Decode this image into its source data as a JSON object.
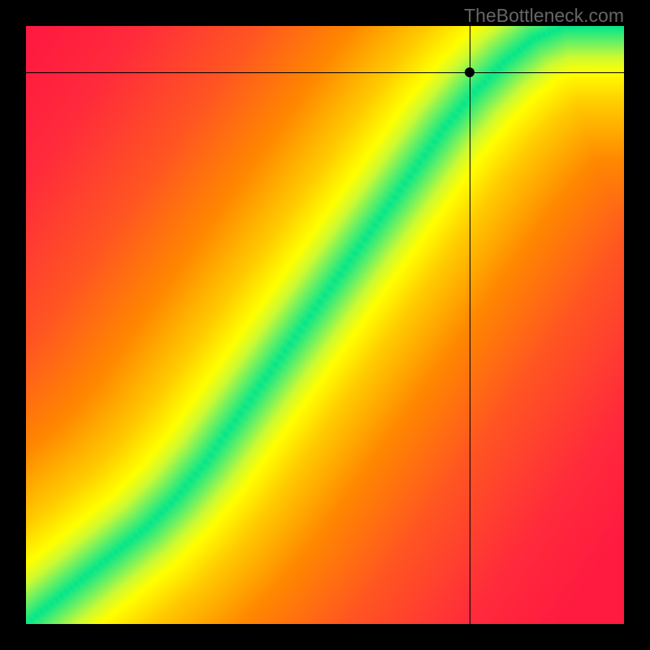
{
  "watermark": "TheBottleneck.com",
  "chart_data": {
    "type": "heatmap",
    "title": "",
    "xlabel": "",
    "ylabel": "",
    "xlim": [
      0,
      1
    ],
    "ylim": [
      0,
      1
    ],
    "crosshair": {
      "x": 0.742,
      "y": 0.922
    },
    "marker": {
      "x": 0.742,
      "y": 0.922
    },
    "optimal_curve": [
      {
        "x": 0.0,
        "y": 0.0
      },
      {
        "x": 0.05,
        "y": 0.04
      },
      {
        "x": 0.1,
        "y": 0.08
      },
      {
        "x": 0.15,
        "y": 0.12
      },
      {
        "x": 0.2,
        "y": 0.16
      },
      {
        "x": 0.25,
        "y": 0.21
      },
      {
        "x": 0.3,
        "y": 0.27
      },
      {
        "x": 0.35,
        "y": 0.34
      },
      {
        "x": 0.4,
        "y": 0.41
      },
      {
        "x": 0.45,
        "y": 0.48
      },
      {
        "x": 0.5,
        "y": 0.55
      },
      {
        "x": 0.55,
        "y": 0.62
      },
      {
        "x": 0.6,
        "y": 0.69
      },
      {
        "x": 0.65,
        "y": 0.76
      },
      {
        "x": 0.7,
        "y": 0.83
      },
      {
        "x": 0.75,
        "y": 0.89
      },
      {
        "x": 0.8,
        "y": 0.94
      },
      {
        "x": 0.85,
        "y": 0.98
      },
      {
        "x": 0.9,
        "y": 1.0
      }
    ],
    "color_stops": [
      {
        "dist": 0.0,
        "color": "#00E68C"
      },
      {
        "dist": 0.04,
        "color": "#66F066"
      },
      {
        "dist": 0.08,
        "color": "#CCFA33"
      },
      {
        "dist": 0.12,
        "color": "#FFFF00"
      },
      {
        "dist": 0.2,
        "color": "#FFCC00"
      },
      {
        "dist": 0.35,
        "color": "#FF8800"
      },
      {
        "dist": 0.55,
        "color": "#FF5522"
      },
      {
        "dist": 0.8,
        "color": "#FF2B3B"
      },
      {
        "dist": 1.0,
        "color": "#FF1A40"
      }
    ]
  }
}
